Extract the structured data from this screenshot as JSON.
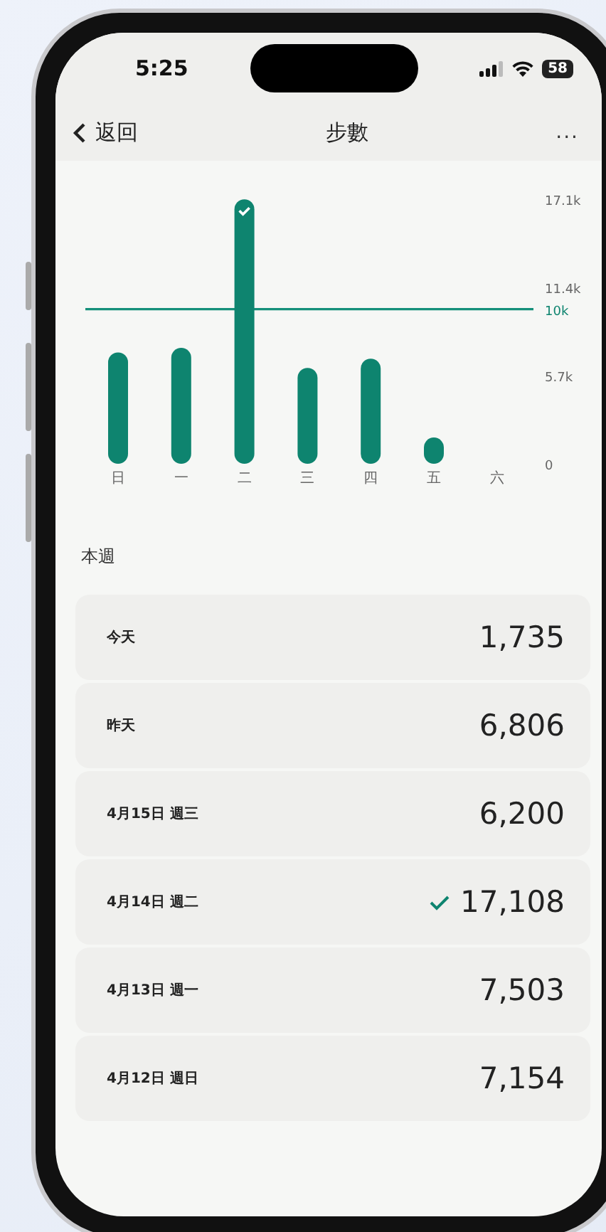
{
  "status_bar": {
    "time": "5:25",
    "battery": "58"
  },
  "nav": {
    "back": "返回",
    "title": "步數",
    "more": "..."
  },
  "chart": {
    "chart_data": {
      "type": "bar",
      "categories": [
        "日",
        "一",
        "二",
        "三",
        "四",
        "五",
        "六"
      ],
      "values": [
        7200,
        7500,
        17100,
        6200,
        6800,
        1700,
        null
      ],
      "ylim": [
        0,
        17200
      ],
      "yticks": [
        {
          "value": 0,
          "label": "0"
        },
        {
          "value": 5700,
          "label": "5.7k"
        },
        {
          "value": 11400,
          "label": "11.4k"
        },
        {
          "value": 17100,
          "label": "17.1k"
        }
      ],
      "ref_lines": [
        {
          "axis": "y",
          "value": 10000,
          "label": "10k"
        }
      ]
    }
  },
  "section_title": "本週",
  "rows": [
    {
      "label": "今天",
      "value": "1,735",
      "goal_met": false
    },
    {
      "label": "昨天",
      "value": "6,806",
      "goal_met": false
    },
    {
      "label": "4月15日 週三",
      "value": "6,200",
      "goal_met": false
    },
    {
      "label": "4月14日 週二",
      "value": "17,108",
      "goal_met": true
    },
    {
      "label": "4月13日 週一",
      "value": "7,503",
      "goal_met": false
    },
    {
      "label": "4月12日 週日",
      "value": "7,154",
      "goal_met": false
    }
  ]
}
